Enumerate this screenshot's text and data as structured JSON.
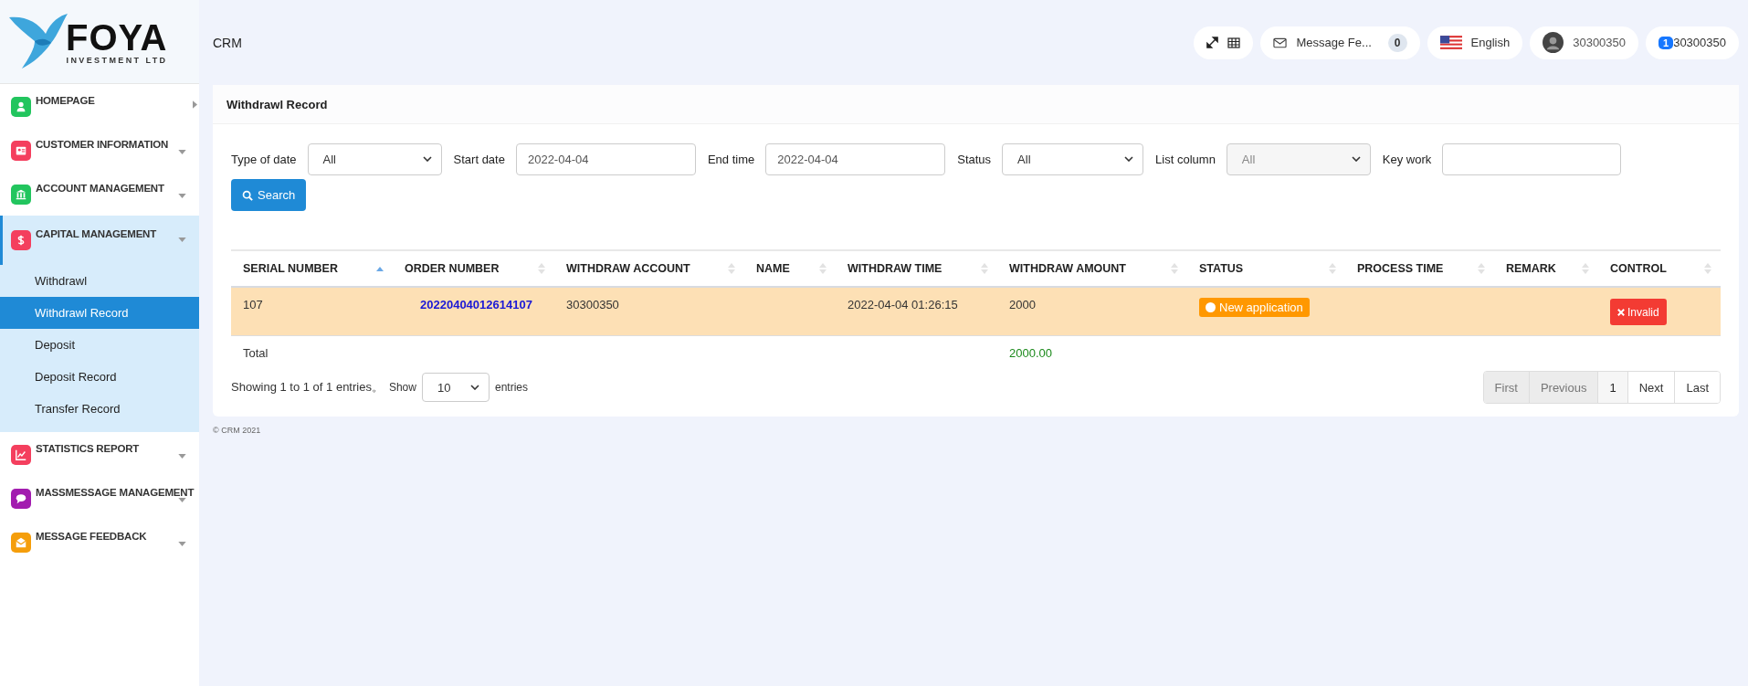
{
  "logo": {
    "name": "FOYA",
    "tagline": "INVESTMENT LTD"
  },
  "header": {
    "page": "CRM",
    "message": {
      "label": "Message Fe...",
      "count": "0"
    },
    "language": "English",
    "user": "30300350",
    "account": {
      "badge": "1",
      "label": "30300350"
    }
  },
  "sidebar": {
    "items": [
      {
        "label": "HOMEPAGE",
        "kind": "link",
        "color": "#22c55e",
        "expanded": false
      },
      {
        "label": "CUSTOMER INFORMATION",
        "kind": "group",
        "color": "#f43f5e",
        "expanded": false
      },
      {
        "label": "ACCOUNT MANAGEMENT",
        "kind": "group",
        "color": "#22c55e",
        "expanded": false
      },
      {
        "label": "CAPITAL MANAGEMENT",
        "kind": "group",
        "color": "#f43f5e",
        "expanded": true,
        "children": [
          {
            "label": "Withdrawl",
            "selected": false
          },
          {
            "label": "Withdrawl Record",
            "selected": true
          },
          {
            "label": "Deposit",
            "selected": false
          },
          {
            "label": "Deposit Record",
            "selected": false
          },
          {
            "label": "Transfer Record",
            "selected": false
          }
        ]
      },
      {
        "label": "STATISTICS REPORT",
        "kind": "group",
        "color": "#f43f5e",
        "expanded": false
      },
      {
        "label": "MASSMESSAGE MANAGEMENT",
        "kind": "group",
        "color": "#a21caf",
        "expanded": false
      },
      {
        "label": "MESSAGE FEEDBACK",
        "kind": "group",
        "color": "#f59e0b",
        "expanded": false
      }
    ]
  },
  "card": {
    "title": "Withdrawl Record"
  },
  "filters": [
    {
      "label": "Type of date",
      "kind": "select",
      "value": "All",
      "disabled": false
    },
    {
      "label": "Start date",
      "kind": "input",
      "value": "2022-04-04"
    },
    {
      "label": "End time",
      "kind": "input",
      "value": "2022-04-04"
    },
    {
      "label": "Status",
      "kind": "select",
      "value": "All",
      "disabled": false
    },
    {
      "label": "List column",
      "kind": "select",
      "value": "All",
      "disabled": true
    },
    {
      "label": "Key work",
      "kind": "input"
    }
  ],
  "search_button": "Search",
  "table": {
    "columns": [
      {
        "label": "SERIAL NUMBER",
        "sorted": true
      },
      {
        "label": "ORDER NUMBER",
        "sorted": false
      },
      {
        "label": "WITHDRAW ACCOUNT",
        "sorted": false
      },
      {
        "label": "NAME",
        "sorted": false
      },
      {
        "label": "WITHDRAW TIME",
        "sorted": false
      },
      {
        "label": "WITHDRAW AMOUNT",
        "sorted": false
      },
      {
        "label": "STATUS",
        "sorted": false
      },
      {
        "label": "PROCESS TIME",
        "sorted": false
      },
      {
        "label": "REMARK",
        "sorted": false
      },
      {
        "label": "CONTROL",
        "sorted": false
      }
    ],
    "rows": [
      {
        "selected": true,
        "serial": "107",
        "order": "20220404012614107",
        "account": "30300350",
        "time": "2022-04-04 01:26:15",
        "amount": "2000",
        "status": {
          "label": "New application",
          "color": "#ff9800"
        },
        "control": "Invalid"
      }
    ],
    "total": {
      "label": "Total",
      "amount": "2000.00"
    }
  },
  "footer": {
    "showing": "Showing 1 to 1 of 1 entries。",
    "show": "Show",
    "page_size": "10",
    "entries": "entries"
  },
  "pagination": [
    {
      "label": "First",
      "disabled": true,
      "selected": false
    },
    {
      "label": "Previous",
      "disabled": true,
      "selected": false
    },
    {
      "label": "1",
      "disabled": false,
      "selected": true
    },
    {
      "label": "Next",
      "disabled": false,
      "selected": false
    },
    {
      "label": "Last",
      "disabled": false,
      "selected": false
    }
  ],
  "copyright": "© CRM 2021"
}
